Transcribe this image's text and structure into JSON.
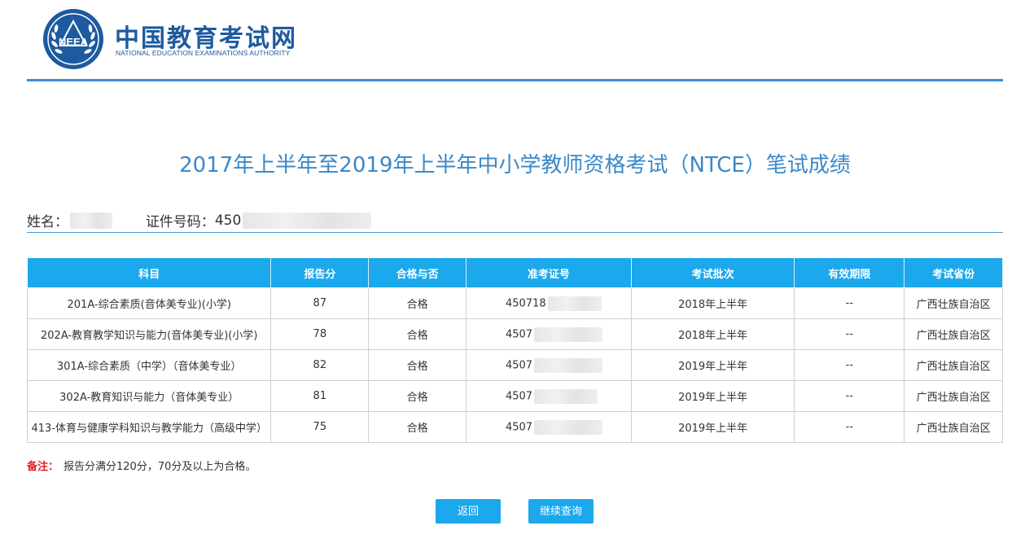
{
  "header": {
    "logo_text": "NEEA",
    "brand_cn": "中国教育考试网",
    "brand_en": "NATIONAL EDUCATION EXAMINATIONS AUTHORITY"
  },
  "title": "2017年上半年至2019年上半年中小学教师资格考试（NTCE）笔试成绩",
  "person": {
    "name_label": "姓名：",
    "name_visible": "",
    "id_label": "证件号码：",
    "id_visible": "450"
  },
  "table": {
    "headers": [
      "科目",
      "报告分",
      "合格与否",
      "准考证号",
      "考试批次",
      "有效期限",
      "考试省份"
    ],
    "rows": [
      {
        "subject": "201A-综合素质(音体美专业)(小学)",
        "score": "87",
        "pass": "合格",
        "ticket": "450718",
        "batch": "2018年上半年",
        "validity": "--",
        "province": "广西壮族自治区"
      },
      {
        "subject": "202A-教育教学知识与能力(音体美专业)(小学)",
        "score": "78",
        "pass": "合格",
        "ticket": "4507",
        "batch": "2018年上半年",
        "validity": "--",
        "province": "广西壮族自治区"
      },
      {
        "subject": "301A-综合素质（中学）（音体美专业）",
        "score": "82",
        "pass": "合格",
        "ticket": "4507",
        "batch": "2019年上半年",
        "validity": "--",
        "province": "广西壮族自治区"
      },
      {
        "subject": "302A-教育知识与能力（音体美专业）",
        "score": "81",
        "pass": "合格",
        "ticket": "4507",
        "batch": "2019年上半年",
        "validity": "--",
        "province": "广西壮族自治区"
      },
      {
        "subject": "413-体育与健康学科知识与教学能力（高级中学）",
        "score": "75",
        "pass": "合格",
        "ticket": "4507",
        "batch": "2019年上半年",
        "validity": "--",
        "province": "广西壮族自治区"
      }
    ]
  },
  "note": {
    "label": "备注：",
    "text": "报告分满分120分，70分及以上为合格。"
  },
  "buttons": {
    "back": "返回",
    "continue": "继续查询"
  },
  "colors": {
    "brand_blue": "#1e5aa0",
    "title_blue": "#3c88c8",
    "header_cell": "#1ba8ec",
    "note_red": "#e02020"
  }
}
